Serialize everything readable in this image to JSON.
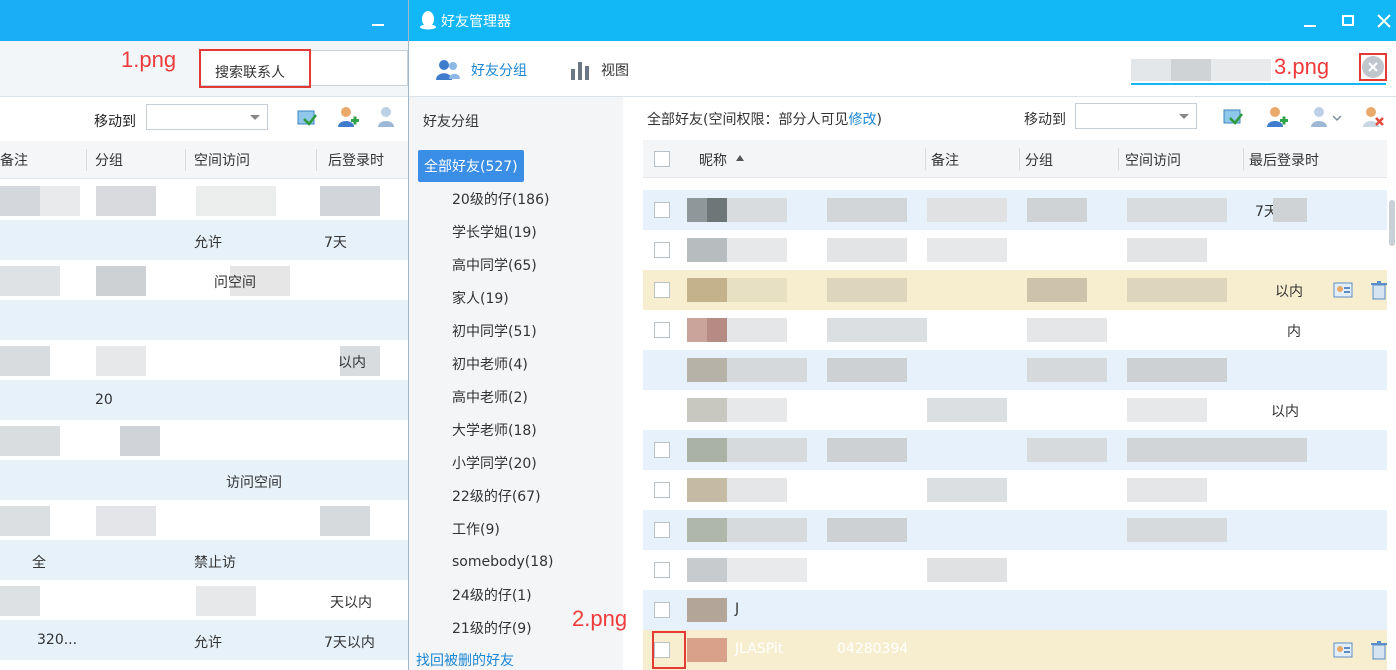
{
  "background_window": {
    "search_placeholder": "搜索联系人",
    "move_to_label": "移动到",
    "columns": [
      "备注",
      "分组",
      "空间访问",
      "后登录时"
    ],
    "visible_fragments": [
      {
        "text": "问空间"
      },
      {
        "text": "允许"
      },
      {
        "text": "7天"
      },
      {
        "text": "以内"
      },
      {
        "text": "20"
      },
      {
        "text": "访问空间"
      },
      {
        "text": "全"
      },
      {
        "text": "禁止访"
      },
      {
        "text": "天以内"
      },
      {
        "text": "320..."
      },
      {
        "text": "7天以内"
      },
      {
        "text": "允许"
      }
    ]
  },
  "main_window": {
    "title": "好友管理器",
    "nav_tabs": [
      {
        "label": "好友分组",
        "active": true,
        "icon": "friends-icon"
      },
      {
        "label": "视图",
        "active": false,
        "icon": "bar-chart-icon"
      }
    ],
    "sidebar": {
      "title": "好友分组",
      "groups": [
        {
          "label": "全部好友(527)",
          "selected": true
        },
        {
          "label": "20级的仔(186)"
        },
        {
          "label": "学长学姐(19)"
        },
        {
          "label": "高中同学(65)"
        },
        {
          "label": "家人(19)"
        },
        {
          "label": "初中同学(51)"
        },
        {
          "label": "初中老师(4)"
        },
        {
          "label": "高中老师(2)"
        },
        {
          "label": "大学老师(18)"
        },
        {
          "label": "小学同学(20)"
        },
        {
          "label": "22级的仔(67)"
        },
        {
          "label": "工作(9)"
        },
        {
          "label": "somebody(18)"
        },
        {
          "label": "24级的仔(1)"
        },
        {
          "label": "21级的仔(9)"
        }
      ],
      "recover_link": "找回被删的好友"
    },
    "content": {
      "info_prefix": "全部好友(空间权限：部分人可见",
      "info_link": "修改",
      "info_suffix": ")",
      "move_to_label": "移动到",
      "columns": {
        "nickname": "昵称",
        "remark": "备注",
        "group": "分组",
        "space_access": "空间访问",
        "last_login": "最后登录时"
      },
      "row_fragments": {
        "r1_last": "7天",
        "r3_last": "以内",
        "r4_last": "内",
        "r6_last": "以内",
        "r12_nick": "J",
        "r13_nick": "JLASPit",
        "r13_remark": "04280394"
      }
    }
  },
  "annotations": {
    "a1": "1.png",
    "a2": "2.png",
    "a3": "3.png"
  },
  "colors": {
    "titlebar": "#12b7f5",
    "accent_blue": "#3a8ee6",
    "link": "#1b86d4",
    "annotation_red": "#ee3b3b"
  }
}
